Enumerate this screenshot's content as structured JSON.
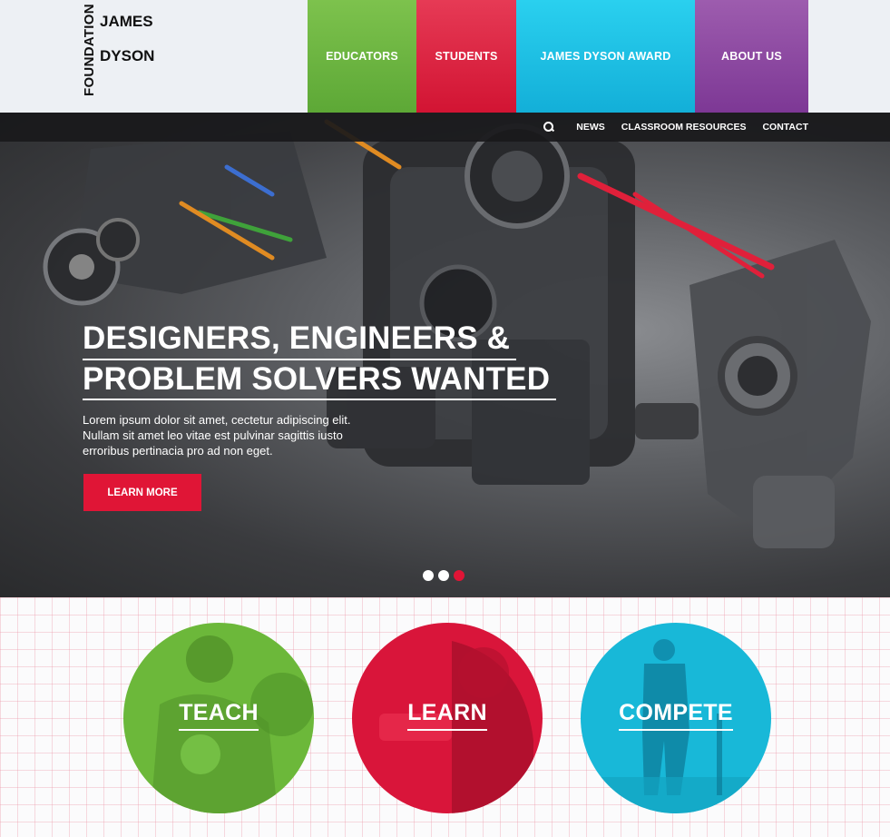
{
  "logo": {
    "vertical": "FOUNDATION",
    "line1": "JAMES",
    "line2": "DYSON"
  },
  "nav": {
    "educators": "EDUCATORS",
    "students": "STUDENTS",
    "award": "JAMES DYSON AWARD",
    "about": "ABOUT US",
    "colors": {
      "educators": "#66ad3c",
      "students": "#d91c3b",
      "award": "#1cbde3",
      "about": "#8a4aa0"
    }
  },
  "subnav": {
    "search_icon": "search-icon",
    "news": "NEWS",
    "resources": "CLASSROOM RESOURCES",
    "contact": "CONTACT"
  },
  "hero": {
    "headline_line1": "DESIGNERS, ENGINEERS &",
    "headline_line2": "PROBLEM SOLVERS WANTED",
    "body_line1": "Lorem ipsum dolor sit amet, cectetur adipiscing elit.",
    "body_line2": "Nullam sit amet leo vitae est pulvinar sagittis iusto",
    "body_line3": "erroribus pertinacia pro ad non eget.",
    "cta": "LEARN MORE",
    "slides": 3,
    "active_slide": 3,
    "accent": "#e01536"
  },
  "features": {
    "teach": "TEACH",
    "learn": "LEARN",
    "compete": "COMPETE"
  }
}
